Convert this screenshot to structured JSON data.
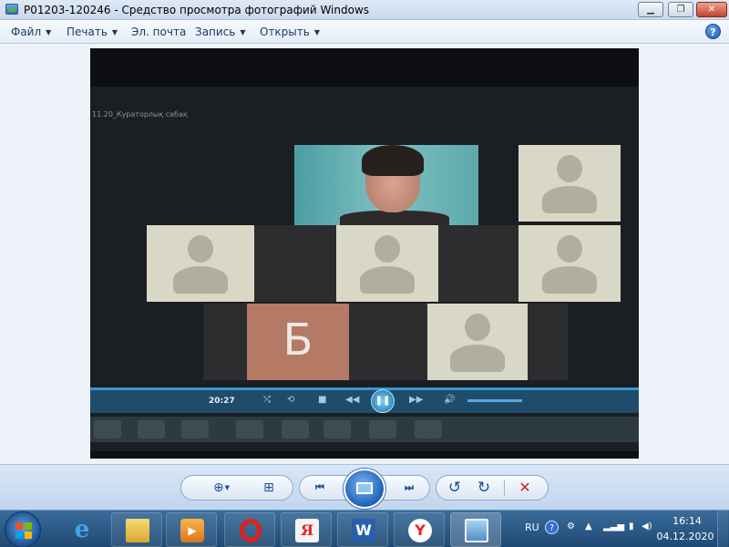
{
  "window": {
    "title": "P01203-120246 - Средство просмотра фотографий Windows",
    "minimize_glyph": "▁",
    "maximize_glyph": "❐",
    "close_glyph": "✕"
  },
  "menu": {
    "items": [
      {
        "label": "Файл",
        "has_dropdown": true
      },
      {
        "label": "Печать",
        "has_dropdown": true
      },
      {
        "label": "Эл. почта",
        "has_dropdown": false
      },
      {
        "label": "Запись",
        "has_dropdown": true
      },
      {
        "label": "Открыть",
        "has_dropdown": true
      }
    ],
    "help_glyph": "?"
  },
  "photo": {
    "caption": "11.20_Кураторлық сабақ",
    "tile_letter": "Б",
    "player_time": "20:27",
    "controls": [
      "⤭",
      "⟲",
      "■",
      "◀◀",
      "▶▶",
      "🔊"
    ],
    "play_glyph": "❚❚"
  },
  "toolbar": {
    "zoom_icon": "search-zoom-icon",
    "zoom_glyph": "⊕",
    "fit_glyph": "⊞",
    "prev_glyph": "⏮",
    "next_glyph": "⏭",
    "rotate_ccw_glyph": "↺",
    "rotate_cw_glyph": "↻",
    "delete_glyph": "✕",
    "colors": {
      "accent": "#1d4f91",
      "delete": "#d0281e"
    }
  },
  "taskbar": {
    "apps": [
      {
        "name": "internet-explorer",
        "glyph": "e"
      },
      {
        "name": "file-explorer",
        "glyph": ""
      },
      {
        "name": "media-player",
        "glyph": "▶"
      },
      {
        "name": "opera",
        "glyph": ""
      },
      {
        "name": "yandex-browser-shortcut",
        "glyph": "Я"
      },
      {
        "name": "microsoft-word",
        "glyph": "W"
      },
      {
        "name": "yandex-browser",
        "glyph": "Y"
      },
      {
        "name": "photo-viewer",
        "glyph": ""
      }
    ],
    "tray": {
      "language": "RU",
      "help_glyph": "?",
      "time": "16:14",
      "date": "04.12.2020"
    }
  }
}
